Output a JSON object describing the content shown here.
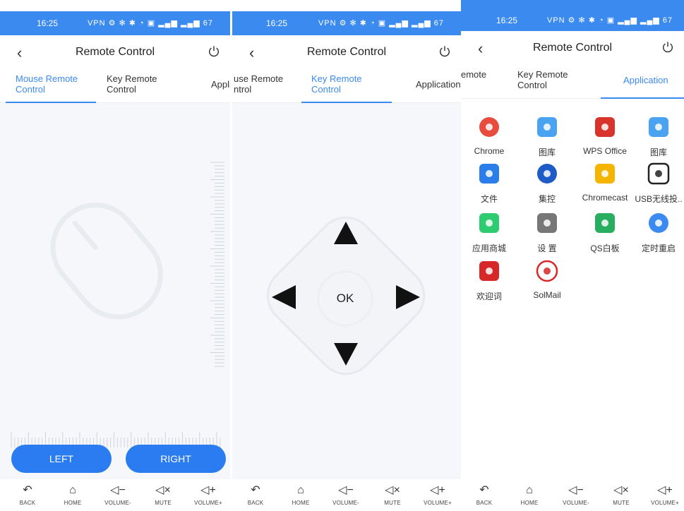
{
  "status": {
    "time": "16:25",
    "icons": "VPN ⚙ ✻ ✱ ◔ ▣ ▂▄▆ ▂▄▆ 67"
  },
  "panels": [
    {
      "title": "Remote Control",
      "tabs": [
        "Mouse Remote\nControl",
        "Key Remote\nControl",
        "Appli"
      ],
      "active_tab": 0,
      "buttons": {
        "left": "LEFT",
        "right": "RIGHT"
      }
    },
    {
      "title": "Remote Control",
      "tabs": [
        "use Remote\nntrol",
        "Key Remote\nControl",
        "Application"
      ],
      "active_tab": 1,
      "ok_label": "OK"
    },
    {
      "title": "Remote Control",
      "tabs": [
        "emote",
        "Key Remote\nControl",
        "Application"
      ],
      "active_tab": 2,
      "apps": [
        {
          "label": "Chrome",
          "icon": "chrome-icon",
          "color": "#e74c3c"
        },
        {
          "label": "图库",
          "icon": "gallery-icon",
          "color": "#4aa3f0"
        },
        {
          "label": "WPS Office",
          "icon": "wps-icon",
          "color": "#d9342b"
        },
        {
          "label": "图库",
          "icon": "gallery-icon",
          "color": "#4aa3f0"
        },
        {
          "label": "文件",
          "icon": "folder-icon",
          "color": "#2b7de9"
        },
        {
          "label": "集控",
          "icon": "sync-icon",
          "color": "#1e5bc6"
        },
        {
          "label": "Chromecast",
          "icon": "cast-icon",
          "color": "#f4b400"
        },
        {
          "label": "USB无线投..",
          "icon": "usb-cast-icon",
          "color": "#222222"
        },
        {
          "label": "应用商城",
          "icon": "store-icon",
          "color": "#2ecc71"
        },
        {
          "label": "设 置",
          "icon": "settings-icon",
          "color": "#777777"
        },
        {
          "label": "QS白板",
          "icon": "whiteboard-icon",
          "color": "#27ae60"
        },
        {
          "label": "定时重启",
          "icon": "timer-restart-icon",
          "color": "#3b8af0"
        },
        {
          "label": "欢迎词",
          "icon": "welcome-icon",
          "color": "#d62828"
        },
        {
          "label": "SolMail",
          "icon": "mail-icon",
          "color": "#d62828"
        }
      ]
    }
  ],
  "nav": [
    {
      "label": "BACK",
      "icon": "↶"
    },
    {
      "label": "HOME",
      "icon": "⌂"
    },
    {
      "label": "VOLUME-",
      "icon": "◁−"
    },
    {
      "label": "MUTE",
      "icon": "◁×"
    },
    {
      "label": "VOLUME+",
      "icon": "◁+"
    }
  ]
}
